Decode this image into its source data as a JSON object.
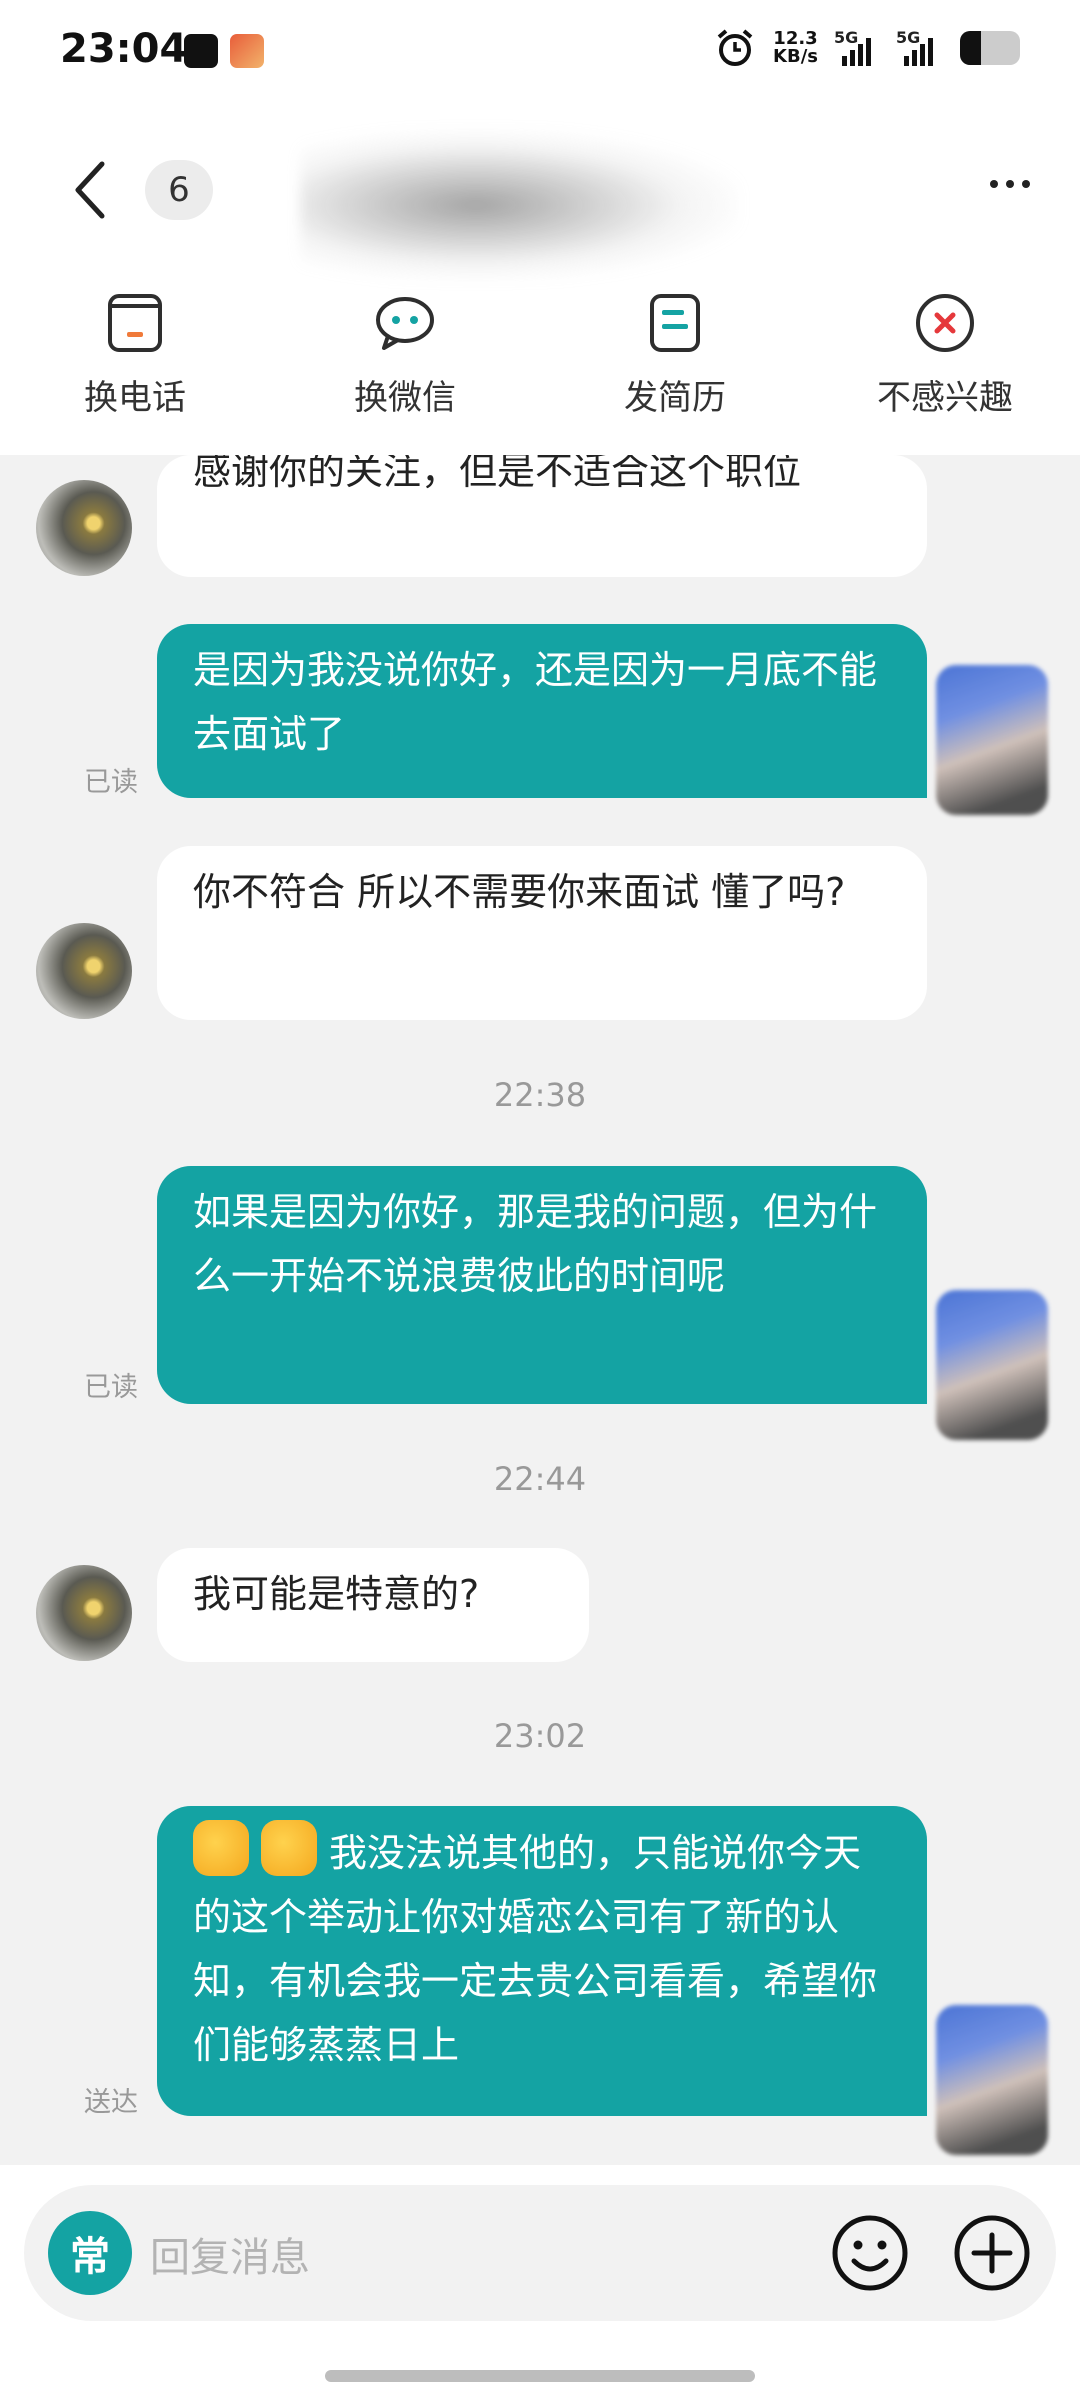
{
  "status_bar": {
    "time": "23:04",
    "net_speed_value": "12.3",
    "net_speed_unit": "KB/s",
    "signal1_label": "5G",
    "signal2_label": "5G",
    "battery_level": 0.35
  },
  "header": {
    "unread_count": "6",
    "actions": [
      {
        "label": "换电话",
        "icon": "phone-card-icon"
      },
      {
        "label": "换微信",
        "icon": "wechat-bubble-icon"
      },
      {
        "label": "发简历",
        "icon": "resume-icon"
      },
      {
        "label": "不感兴趣",
        "icon": "not-interested-icon"
      }
    ]
  },
  "messages": [
    {
      "id": "m0",
      "dir": "in",
      "text": "感谢你的关注，但是不适合这个职位"
    },
    {
      "id": "m1",
      "dir": "out",
      "text": "是因为我没说你好，还是因为一月底不能去面试了",
      "status": "已读"
    },
    {
      "id": "m2",
      "dir": "in",
      "text": "你不符合 所以不需要你来面试 懂了吗?"
    },
    {
      "id": "t1",
      "type": "time",
      "text": "22:38"
    },
    {
      "id": "m3",
      "dir": "out",
      "text": "如果是因为你好，那是我的问题，但为什么一开始不说浪费彼此的时间呢",
      "status": "已读"
    },
    {
      "id": "t2",
      "type": "time",
      "text": "22:44"
    },
    {
      "id": "m4",
      "dir": "in",
      "text": "我可能是特意的?"
    },
    {
      "id": "t3",
      "type": "time",
      "text": "23:02"
    },
    {
      "id": "m5",
      "dir": "out",
      "emoji": "thumbs-up-emoji",
      "text": "我没法说其他的，只能说你今天的这个举动让你对婚恋公司有了新的认知，有机会我一定去贵公司看看，希望你们能够蒸蒸日上",
      "status": "送达"
    }
  ],
  "input_bar": {
    "quick_label": "常",
    "placeholder": "回复消息"
  },
  "colors": {
    "accent": "#14a3a3",
    "background": "#f2f2f2",
    "not_interested_red": "#e5383b",
    "phone_orange": "#f07a3a"
  }
}
